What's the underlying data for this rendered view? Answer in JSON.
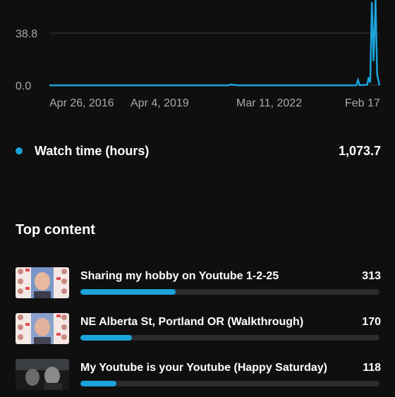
{
  "colors": {
    "accent": "#1ca3d9",
    "track": "#2c2c2c",
    "background": "#0f0f0f"
  },
  "chart_data": {
    "type": "line",
    "y_ticks": [
      "38.8",
      "0.0"
    ],
    "y_tick_values": [
      38.8,
      0.0
    ],
    "x_ticks": [
      "Apr 26, 2016",
      "Apr 4, 2019",
      "Mar 11, 2022",
      "Feb 17"
    ],
    "series": [
      {
        "name": "Watch time (hours)",
        "points": [
          [
            0,
            0.0
          ],
          [
            0.3,
            0.0
          ],
          [
            0.54,
            0.0
          ],
          [
            0.55,
            0.6
          ],
          [
            0.56,
            0.3
          ],
          [
            0.57,
            0.0
          ],
          [
            0.75,
            0.0
          ],
          [
            0.88,
            0.0
          ],
          [
            0.93,
            0.0
          ],
          [
            0.935,
            4.0
          ],
          [
            0.94,
            0.0
          ],
          [
            0.963,
            0.5
          ],
          [
            0.967,
            6.0
          ],
          [
            0.972,
            2.0
          ],
          [
            0.977,
            62.0
          ],
          [
            0.982,
            18.0
          ],
          [
            0.988,
            70.0
          ],
          [
            0.993,
            8.0
          ],
          [
            1.0,
            0.0
          ]
        ]
      }
    ]
  },
  "legend": {
    "label": "Watch time (hours)",
    "value": "1,073.7"
  },
  "top_content": {
    "title": "Top content",
    "videos": [
      {
        "title": "Sharing my hobby on Youtube 1-2-25",
        "count": "313",
        "fraction": 0.318
      },
      {
        "title": "NE Alberta St, Portland OR (Walkthrough)",
        "count": "170",
        "fraction": 0.173
      },
      {
        "title": "My Youtube is your Youtube (Happy Saturday)",
        "count": "118",
        "fraction": 0.12
      }
    ]
  }
}
